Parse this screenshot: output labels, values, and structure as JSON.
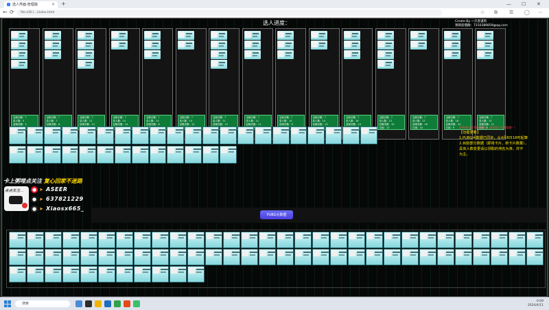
{
  "browser": {
    "tab_title": "选人界面-管理端",
    "url": "file:///D:/…/index.html",
    "new_tab": "+",
    "minimize": "—",
    "maximize": "☐",
    "close": "✕"
  },
  "page": {
    "title": "选人进度：",
    "credit_line1": "Create By 一只赤道鸡",
    "credit_line2": "项目反馈群：7150389859@qq.com"
  },
  "columns": [
    {
      "stat": "当前分数：？\n总人数：5\n召唤次数：2\n已用：1"
    },
    {
      "stat": "当前分数：？\n总人数：7\n召唤次数：8\n已用：10"
    },
    {
      "stat": "当前分数：？\n总人数：21\n召唤次数：12\n已用：7"
    },
    {
      "stat": "当前分数：？\n总人数：14\n召唤次数：14\n已用：5"
    },
    {
      "stat": "当前分数：？\n总人数：13\n召唤次数：6\n已用：10"
    },
    {
      "stat": "当前分数：？\n总人数：14\n召唤次数：12\n已用：8"
    },
    {
      "stat": "当前分数：？\n总人数：11\n召唤次数：12\n已用：6"
    },
    {
      "stat": "当前分数：？\n总人数：11\n召唤次数：11\n已用：9"
    },
    {
      "stat": "当前分数：？\n总人数：14\n召唤次数：9\n已用：12"
    },
    {
      "stat": "当前分数：？\n总人数：14\n召唤次数：13\n已用：11"
    },
    {
      "stat": "当前分数：？\n总人数：16\n召唤次数：13\n已用：9"
    },
    {
      "stat": "当前分数：？\n总人数：13\n召唤次数：15\n已用：13"
    },
    {
      "stat": "当前分数：？\n总人数：17\n召唤次数：16\n已用：10"
    },
    {
      "stat": "当前分数：？\n总人数：18\n召唤次数：12\n已用：9"
    },
    {
      "stat": "当前分数：？\n总人数：13\n召唤次数：11\n已用：8"
    }
  ],
  "notice": {
    "small": "本系统仅用于娱乐用途，请勿用于非法用途！！",
    "head": "【功能更新】",
    "line1": "1.PUBG大数据已同步，从4月8日18时起算",
    "line2": "2.目前部分数据（即将卡片、新卡片数量），",
    "line3": "具体人数变更请以领取的排名为准，并不",
    "line4": "为主。"
  },
  "follow": {
    "part1": "卡上粥哩点关注",
    "part2": "复心回家不迷路"
  },
  "sticker_text": "点点关注...",
  "contacts": [
    {
      "icon": "weibo-icon",
      "color": "#e6162d",
      "arrow": "➤",
      "text": "ASEER"
    },
    {
      "icon": "qq-icon",
      "color": "#1d1d1d",
      "arrow": "➤",
      "text": "637821229"
    },
    {
      "icon": "douyin-icon",
      "color": "#2a2a2a",
      "arrow": "➤",
      "text": "Xiaosx665_"
    }
  ],
  "action": {
    "button": "PUBG大数据"
  },
  "taskbar": {
    "search_placeholder": "搜索",
    "time": "0:09",
    "date": "2024/4/11"
  }
}
